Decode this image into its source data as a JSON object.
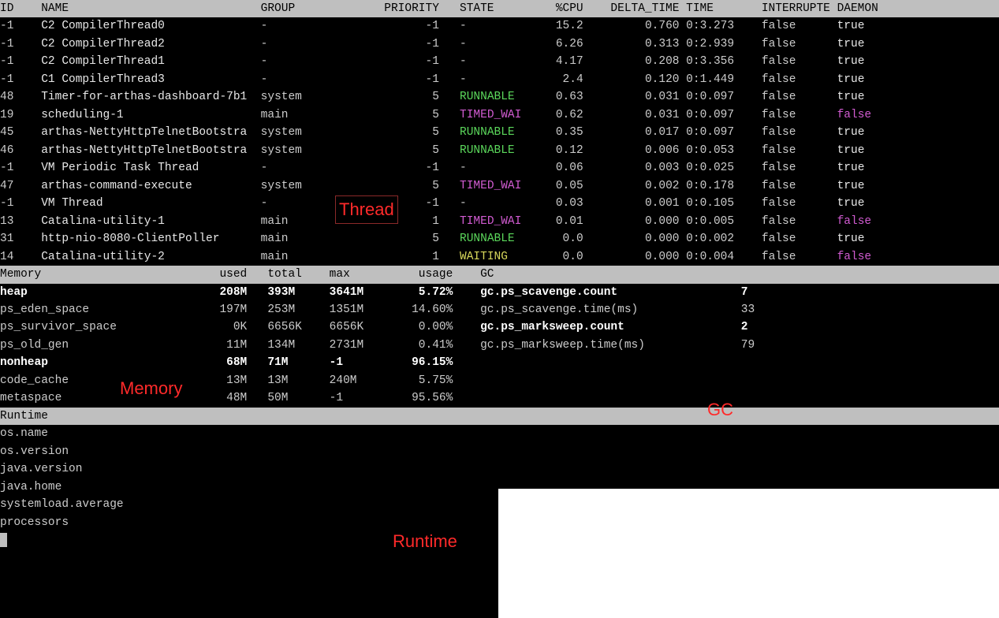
{
  "thread_header": {
    "id": "ID",
    "name": "NAME",
    "group": "GROUP",
    "priority": "PRIORITY",
    "state": "STATE",
    "cpu": "%CPU",
    "delta_time": "DELTA_TIME",
    "time": "TIME",
    "interrupte": "INTERRUPTE",
    "daemon": "DAEMON"
  },
  "threads": [
    {
      "id": "-1",
      "name": "C2 CompilerThread0",
      "group": "-",
      "priority": "-1",
      "state": "-",
      "cpu": "15.2",
      "delta_time": "0.760",
      "time": "0:3.273",
      "interrupte": "false",
      "daemon": "true",
      "daemon_color": "white"
    },
    {
      "id": "-1",
      "name": "C2 CompilerThread2",
      "group": "-",
      "priority": "-1",
      "state": "-",
      "cpu": "6.26",
      "delta_time": "0.313",
      "time": "0:2.939",
      "interrupte": "false",
      "daemon": "true",
      "daemon_color": "white"
    },
    {
      "id": "-1",
      "name": "C2 CompilerThread1",
      "group": "-",
      "priority": "-1",
      "state": "-",
      "cpu": "4.17",
      "delta_time": "0.208",
      "time": "0:3.356",
      "interrupte": "false",
      "daemon": "true",
      "daemon_color": "white"
    },
    {
      "id": "-1",
      "name": "C1 CompilerThread3",
      "group": "-",
      "priority": "-1",
      "state": "-",
      "cpu": "2.4",
      "delta_time": "0.120",
      "time": "0:1.449",
      "interrupte": "false",
      "daemon": "true",
      "daemon_color": "white"
    },
    {
      "id": "48",
      "name": "Timer-for-arthas-dashboard-7b1",
      "group": "system",
      "priority": "5",
      "state": "RUNNABLE",
      "state_color": "green",
      "cpu": "0.63",
      "delta_time": "0.031",
      "time": "0:0.097",
      "interrupte": "false",
      "daemon": "true",
      "daemon_color": "white"
    },
    {
      "id": "19",
      "name": "scheduling-1",
      "group": "main",
      "priority": "5",
      "state": "TIMED_WAI",
      "state_color": "magenta",
      "cpu": "0.62",
      "delta_time": "0.031",
      "time": "0:0.097",
      "interrupte": "false",
      "daemon": "false",
      "daemon_color": "magenta"
    },
    {
      "id": "45",
      "name": "arthas-NettyHttpTelnetBootstra",
      "group": "system",
      "priority": "5",
      "state": "RUNNABLE",
      "state_color": "green",
      "cpu": "0.35",
      "delta_time": "0.017",
      "time": "0:0.097",
      "interrupte": "false",
      "daemon": "true",
      "daemon_color": "white"
    },
    {
      "id": "46",
      "name": "arthas-NettyHttpTelnetBootstra",
      "group": "system",
      "priority": "5",
      "state": "RUNNABLE",
      "state_color": "green",
      "cpu": "0.12",
      "delta_time": "0.006",
      "time": "0:0.053",
      "interrupte": "false",
      "daemon": "true",
      "daemon_color": "white"
    },
    {
      "id": "-1",
      "name": "VM Periodic Task Thread",
      "group": "-",
      "priority": "-1",
      "state": "-",
      "cpu": "0.06",
      "delta_time": "0.003",
      "time": "0:0.025",
      "interrupte": "false",
      "daemon": "true",
      "daemon_color": "white"
    },
    {
      "id": "47",
      "name": "arthas-command-execute",
      "group": "system",
      "priority": "5",
      "state": "TIMED_WAI",
      "state_color": "magenta",
      "cpu": "0.05",
      "delta_time": "0.002",
      "time": "0:0.178",
      "interrupte": "false",
      "daemon": "true",
      "daemon_color": "white"
    },
    {
      "id": "-1",
      "name": "VM Thread",
      "group": "-",
      "priority": "-1",
      "state": "-",
      "cpu": "0.03",
      "delta_time": "0.001",
      "time": "0:0.105",
      "interrupte": "false",
      "daemon": "true",
      "daemon_color": "white"
    },
    {
      "id": "13",
      "name": "Catalina-utility-1",
      "group": "main",
      "priority": "1",
      "state": "TIMED_WAI",
      "state_color": "magenta",
      "cpu": "0.01",
      "delta_time": "0.000",
      "time": "0:0.005",
      "interrupte": "false",
      "daemon": "false",
      "daemon_color": "magenta"
    },
    {
      "id": "31",
      "name": "http-nio-8080-ClientPoller",
      "group": "main",
      "priority": "5",
      "state": "RUNNABLE",
      "state_color": "green",
      "cpu": "0.0",
      "delta_time": "0.000",
      "time": "0:0.002",
      "interrupte": "false",
      "daemon": "true",
      "daemon_color": "white"
    },
    {
      "id": "14",
      "name": "Catalina-utility-2",
      "group": "main",
      "priority": "1",
      "state": "WAITING",
      "state_color": "yellow",
      "cpu": "0.0",
      "delta_time": "0.000",
      "time": "0:0.004",
      "interrupte": "false",
      "daemon": "false",
      "daemon_color": "magenta"
    }
  ],
  "memory_header": {
    "memory": "Memory",
    "used": "used",
    "total": "total",
    "max": "max",
    "usage": "usage",
    "gc": "GC"
  },
  "memory": [
    {
      "name": "heap",
      "used": "208M",
      "total": "393M",
      "max": "3641M",
      "usage": "5.72%",
      "bold": true
    },
    {
      "name": "ps_eden_space",
      "used": "197M",
      "total": "253M",
      "max": "1351M",
      "usage": "14.60%",
      "bold": false
    },
    {
      "name": "ps_survivor_space",
      "used": "0K",
      "total": "6656K",
      "max": "6656K",
      "usage": "0.00%",
      "bold": false
    },
    {
      "name": "ps_old_gen",
      "used": "11M",
      "total": "134M",
      "max": "2731M",
      "usage": "0.41%",
      "bold": false
    },
    {
      "name": "nonheap",
      "used": "68M",
      "total": "71M",
      "max": "-1",
      "usage": "96.15%",
      "bold": true
    },
    {
      "name": "code_cache",
      "used": "13M",
      "total": "13M",
      "max": "240M",
      "usage": "5.75%",
      "bold": false
    },
    {
      "name": "metaspace",
      "used": "48M",
      "total": "50M",
      "max": "-1",
      "usage": "95.56%",
      "bold": false
    }
  ],
  "gc": [
    {
      "name": "gc.ps_scavenge.count",
      "value": "7",
      "bold": true
    },
    {
      "name": "gc.ps_scavenge.time(ms)",
      "value": "33",
      "bold": false
    },
    {
      "name": "gc.ps_marksweep.count",
      "value": "2",
      "bold": true
    },
    {
      "name": "gc.ps_marksweep.time(ms)",
      "value": "79",
      "bold": false
    }
  ],
  "runtime_header": "Runtime",
  "runtime": [
    "os.name",
    "os.version",
    "java.version",
    "java.home",
    "",
    "systemload.average",
    "processors"
  ],
  "annotations": {
    "thread": "Thread",
    "memory": "Memory",
    "gc": "GC",
    "runtime": "Runtime"
  }
}
